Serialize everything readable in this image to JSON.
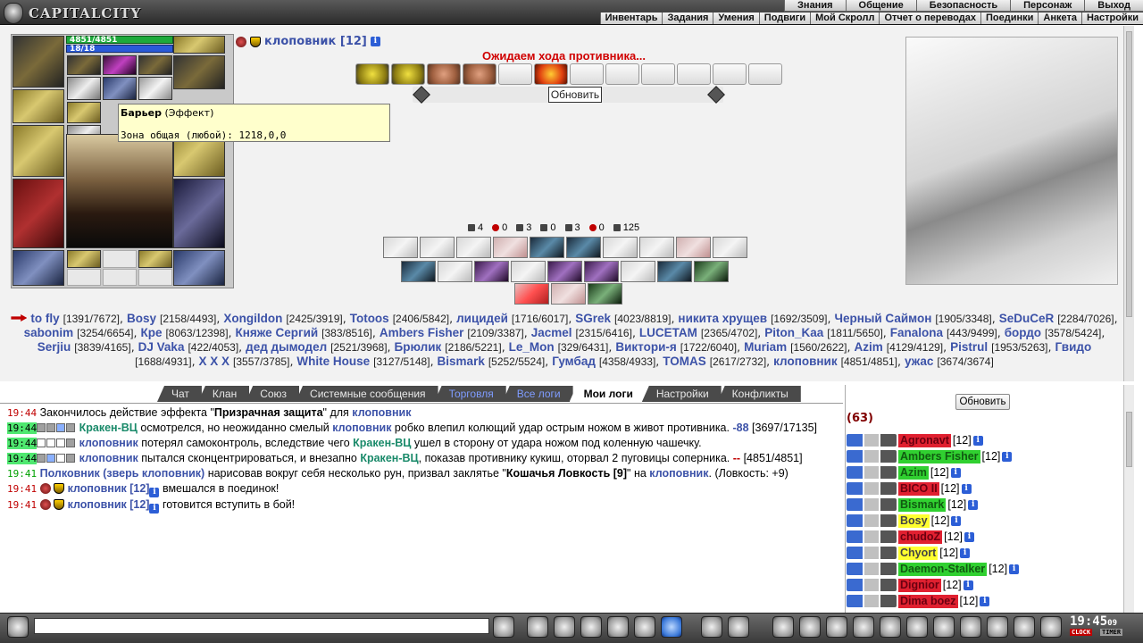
{
  "app": {
    "logo_text": "CAPITALCITY"
  },
  "top_menu": [
    "Знания",
    "Общение",
    "Безопасность",
    "Персонаж",
    "Выход"
  ],
  "sub_menu": [
    "Инвентарь",
    "Задания",
    "Умения",
    "Подвиги",
    "Мой Скролл",
    "Отчет о переводах",
    "Поединки",
    "Анкета",
    "Настройки"
  ],
  "character": {
    "hp": "4851/4851",
    "mp": "18/18"
  },
  "tooltip": {
    "title": "Барьер",
    "kind": "(Эффект)",
    "zone": "Зона общая (любой): 1218,0,0"
  },
  "player": {
    "name": "клоповник",
    "level": "[12]"
  },
  "battle": {
    "status": "Ожидаем хода противника...",
    "refresh_label": "Обновить",
    "stats": [
      "4",
      "0",
      "3",
      "0",
      "3",
      "0",
      "125"
    ]
  },
  "participants": [
    {
      "name": "to fly",
      "hp": "[1391/7672]"
    },
    {
      "name": "Bosy",
      "hp": "[2158/4493]"
    },
    {
      "name": "Xongildon",
      "hp": "[2425/3919]"
    },
    {
      "name": "Totoos",
      "hp": "[2406/5842]"
    },
    {
      "name": "лицидей",
      "hp": "[1716/6017]"
    },
    {
      "name": "SGrek",
      "hp": "[4023/8819]"
    },
    {
      "name": "никита хрущев",
      "hp": "[1692/3509]"
    },
    {
      "name": "Черный Саймон",
      "hp": "[1905/3348]"
    },
    {
      "name": "SeDuCeR",
      "hp": "[2284/7026]"
    },
    {
      "name": "sabonim",
      "hp": "[3254/6654]"
    },
    {
      "name": "Кре",
      "hp": "[8063/12398]"
    },
    {
      "name": "Княже Сергий",
      "hp": "[383/8516]"
    },
    {
      "name": "Ambers Fisher",
      "hp": "[2109/3387]"
    },
    {
      "name": "Jacmel",
      "hp": "[2315/6416]"
    },
    {
      "name": "LUCETAM",
      "hp": "[2365/4702]"
    },
    {
      "name": "Piton_Kaa",
      "hp": "[1811/5650]"
    },
    {
      "name": "Fanalona",
      "hp": "[443/9499]"
    },
    {
      "name": "бордо",
      "hp": "[3578/5424]"
    },
    {
      "name": "Serjiu",
      "hp": "[3839/4165]"
    },
    {
      "name": "DJ Vaka",
      "hp": "[422/4053]"
    },
    {
      "name": "дед дымодел",
      "hp": "[2521/3968]"
    },
    {
      "name": "Брюлик",
      "hp": "[2186/5221]"
    },
    {
      "name": "Le_Mon",
      "hp": "[329/6431]"
    },
    {
      "name": "Виктори-я",
      "hp": "[1722/6040]"
    },
    {
      "name": "Muriam",
      "hp": "[1560/2622]"
    },
    {
      "name": "Azim",
      "hp": "[4129/4129]"
    },
    {
      "name": "Pistrul",
      "hp": "[1953/5263]"
    },
    {
      "name": "Гвидо",
      "hp": "[1688/4931]"
    },
    {
      "name": "X X X",
      "hp": "[3557/3785]"
    },
    {
      "name": "White House",
      "hp": "[3127/5148]"
    },
    {
      "name": "Bismark",
      "hp": "[5252/5524]"
    },
    {
      "name": "Гумбад",
      "hp": "[4358/4933]"
    },
    {
      "name": "TOMAS",
      "hp": "[2617/2732]"
    },
    {
      "name": "клоповник",
      "hp": "[4851/4851]"
    },
    {
      "name": "ужас",
      "hp": "[3674/3674]"
    }
  ],
  "tabs": [
    "Чат",
    "Клан",
    "Союз",
    "Системные сообщения",
    "Торговля",
    "Все логи",
    "Мои логи",
    "Настройки",
    "Конфликты"
  ],
  "log": {
    "l1": {
      "time": "19:44",
      "a": "Закончилось действие эффекта ",
      "effect": "Призрачная защита",
      "b": " для ",
      "who": "клоповник"
    },
    "l2": {
      "time": "19:44",
      "who": "Кракен-ВЦ",
      "a": " осмотрелся, но неожиданно смелый ",
      "who2": "клоповник",
      "b": " робко влепил колющий удар острым ножом в живот противника. ",
      "dmg": "-88",
      "hp": " [3697/17135]"
    },
    "l3": {
      "time": "19:44",
      "who": "клоповник",
      "a": " потерял самоконтроль, вследствие чего ",
      "who2": "Кракен-ВЦ",
      "b": " ушел в сторону от удара ножом под коленную чашечку."
    },
    "l4": {
      "time": "19:44",
      "who": "клоповник",
      "a": " пытался сконцентрироваться, и внезапно ",
      "who2": "Кракен-ВЦ",
      "b": ", показав противнику кукиш, оторвал 2 пуговицы соперника. ",
      "dmg": "--",
      "hp": " [4851/4851]"
    },
    "l5": {
      "time": "19:41",
      "who": "Полковник (зверь клоповник)",
      "a": " нарисовав вокруг себя несколько рун, призвал заклятье \"",
      "spell": "Кошачья Ловкость [9]",
      "b": "\" на ",
      "who2": "клоповник",
      "c": ".",
      "d": "(Ловкость: +9)"
    },
    "l6": {
      "time": "19:41",
      "who": "клоповник [12]",
      "a": " вмешался в поединок!"
    },
    "l7": {
      "time": "19:41",
      "who": "клоповник [12]",
      "a": " готовится вступить в бой!"
    }
  },
  "online": {
    "refresh_label": "Обновить",
    "count": "(63)",
    "users": [
      {
        "name": "Agronavt",
        "level": "[12]",
        "color": "r"
      },
      {
        "name": "Ambers Fisher",
        "level": "[12]",
        "color": "g"
      },
      {
        "name": "Azim",
        "level": "[12]",
        "color": "g"
      },
      {
        "name": "BICO II",
        "level": "[12]",
        "color": "r"
      },
      {
        "name": "Bismark",
        "level": "[12]",
        "color": "g"
      },
      {
        "name": "Bosy",
        "level": "[12]",
        "color": "y"
      },
      {
        "name": "chudoZ",
        "level": "[12]",
        "color": "r"
      },
      {
        "name": "Chyort",
        "level": "[12]",
        "color": "y"
      },
      {
        "name": "Daemon-Stalker",
        "level": "[12]",
        "color": "g"
      },
      {
        "name": "Dignior",
        "level": "[12]",
        "color": "r"
      },
      {
        "name": "Dima boez",
        "level": "[12]",
        "color": "r"
      }
    ]
  },
  "clock": {
    "time": "19:45",
    "seconds": "09",
    "label_a": "CLOCK",
    "label_b": "TIMER"
  },
  "colors": {
    "hp_green": "#1eaa3c",
    "mp_blue": "#2a5ad8",
    "name_blue": "#3c52a8",
    "status_red": "#d00000"
  }
}
